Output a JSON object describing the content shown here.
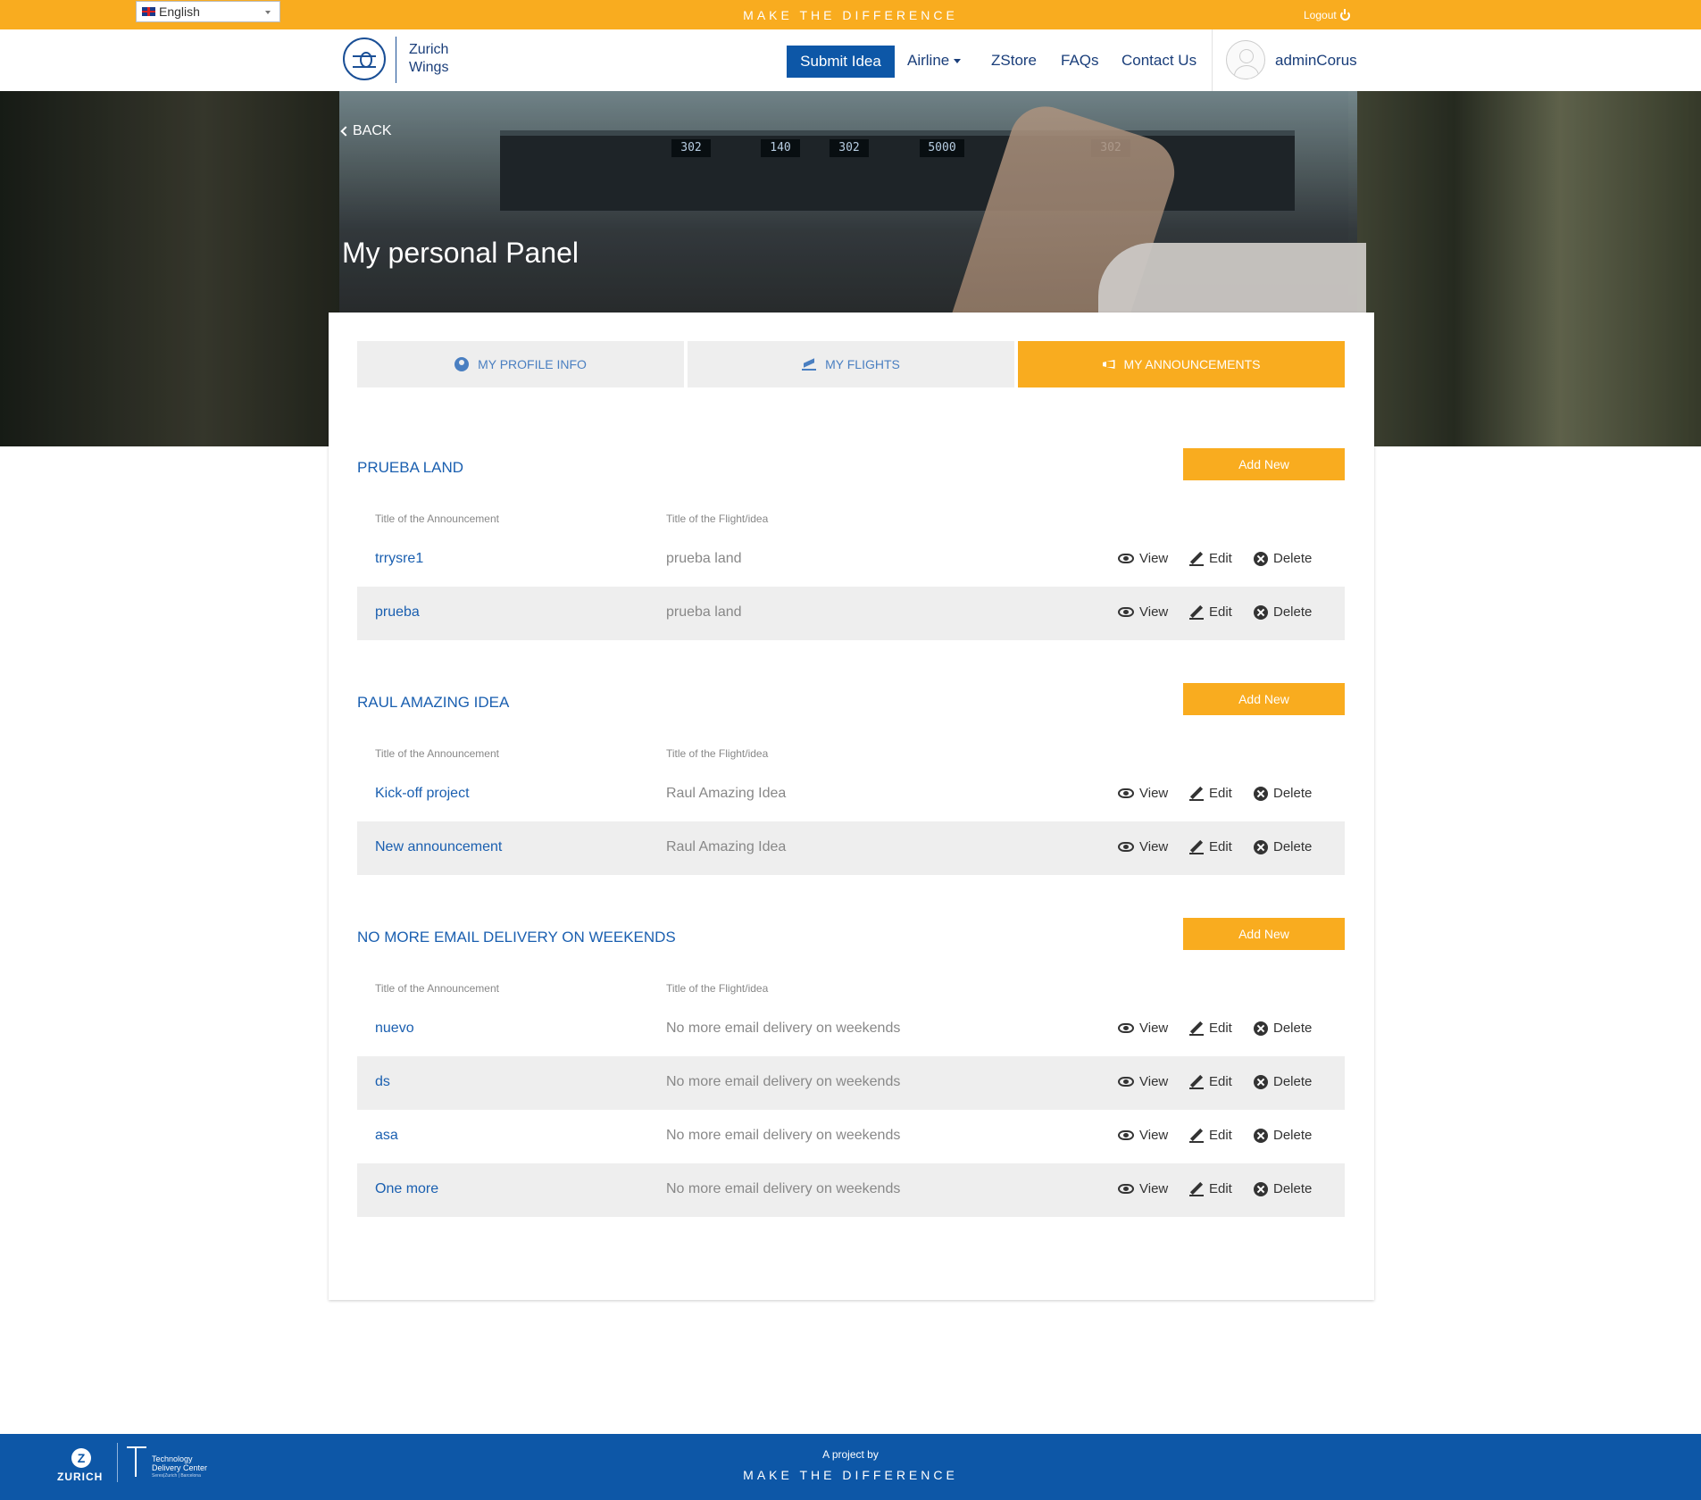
{
  "topbar": {
    "language": "English",
    "tagline": "MAKE THE DIFFERENCE",
    "logout_label": "Logout"
  },
  "header": {
    "brand_line1": "Zurich",
    "brand_line2": "Wings",
    "submit_label": "Submit Idea",
    "nav": {
      "airline": "Airline",
      "zstore": "ZStore",
      "faqs": "FAQs",
      "contact": "Contact Us"
    },
    "username": "adminCorus"
  },
  "hero": {
    "back_label": "BACK",
    "title": "My personal Panel",
    "displays": [
      "302",
      "140",
      "302",
      "5000",
      "302"
    ]
  },
  "tabs": {
    "profile": "MY PROFILE INFO",
    "flights": "MY FLIGHTS",
    "announcements": "MY ANNOUNCEMENTS"
  },
  "columns": {
    "announcement": "Title of the Announcement",
    "flight": "Title of the Flight/idea"
  },
  "actions": {
    "view": "View",
    "edit": "Edit",
    "delete": "Delete"
  },
  "add_new_label": "Add New",
  "sections": [
    {
      "title": "PRUEBA LAND",
      "rows": [
        {
          "title": "trrysre1",
          "flight": "prueba land"
        },
        {
          "title": "prueba",
          "flight": "prueba land"
        }
      ]
    },
    {
      "title": "RAUL AMAZING IDEA",
      "rows": [
        {
          "title": "Kick-off project",
          "flight": "Raul Amazing Idea"
        },
        {
          "title": "New announcement",
          "flight": "Raul Amazing Idea"
        }
      ]
    },
    {
      "title": "NO MORE EMAIL DELIVERY ON WEEKENDS",
      "rows": [
        {
          "title": "nuevo",
          "flight": "No more email delivery on weekends"
        },
        {
          "title": "ds",
          "flight": "No more email delivery on weekends"
        },
        {
          "title": "asa",
          "flight": "No more email delivery on weekends"
        },
        {
          "title": "One more",
          "flight": "No more email delivery on weekends"
        }
      ]
    }
  ],
  "footer": {
    "zurich": "ZURICH",
    "tdc_line1": "Technology",
    "tdc_line2": "Delivery Center",
    "tdc_sub": "Seres|Zurich | Barcelona",
    "project_by": "A project by",
    "tagline": "MAKE THE DIFFERENCE"
  },
  "colors": {
    "accent": "#f9ac1f",
    "brand_blue": "#0d57a7",
    "link_blue": "#1a5fb0"
  }
}
